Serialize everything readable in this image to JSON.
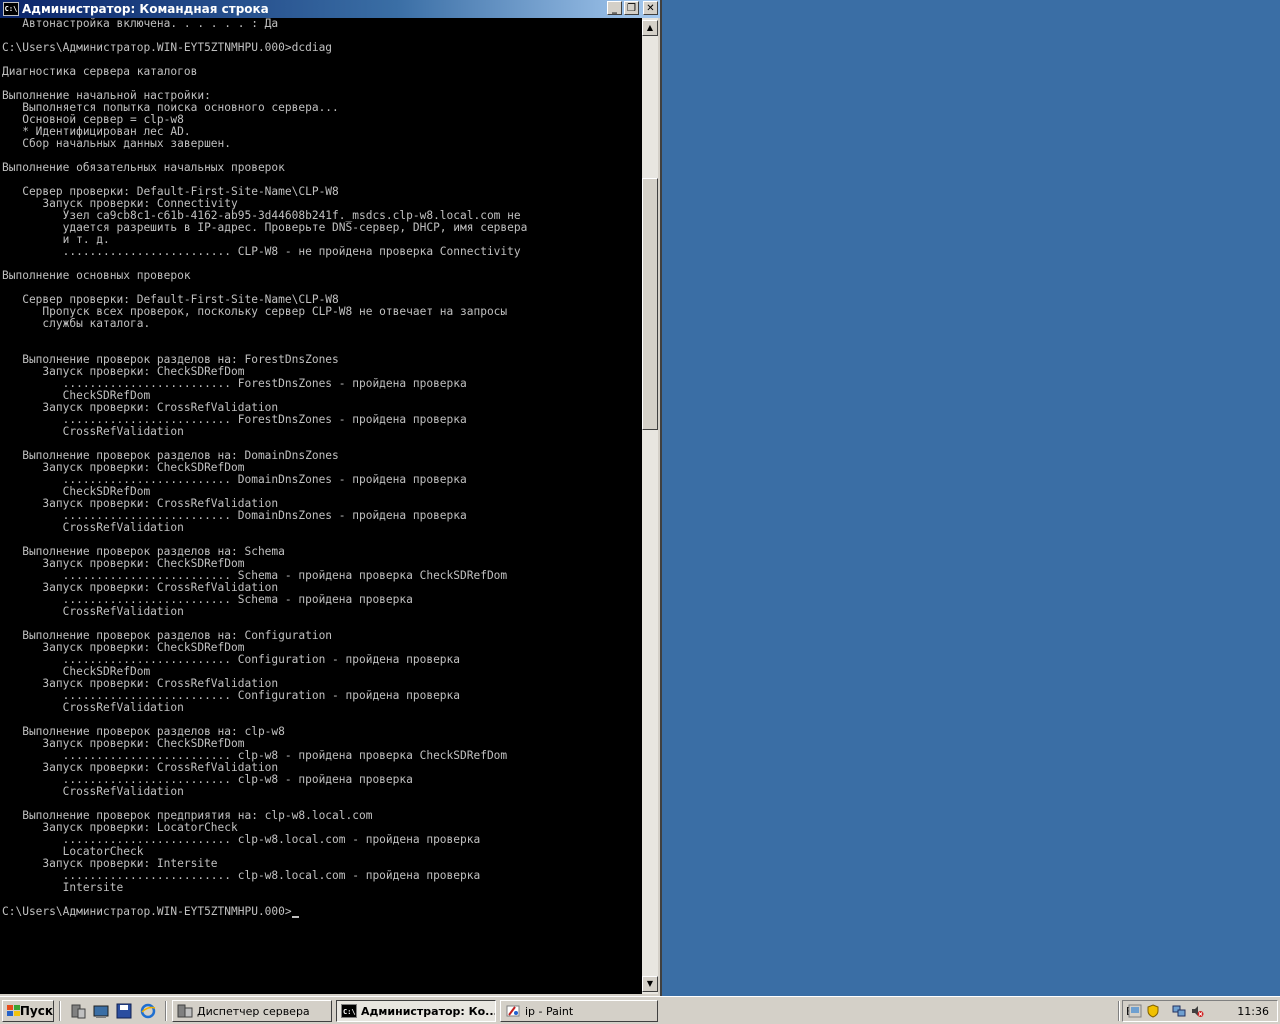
{
  "window": {
    "title": "Администратор: Командная строка",
    "app_icon_text": "C:\\",
    "buttons": {
      "minimize": "_",
      "maximize": "❐",
      "close": "✕"
    }
  },
  "console_lines": [
    "   Автонастройка включена. . . . . . : Да",
    "",
    "C:\\Users\\Администратор.WIN-EYT5ZTNMHPU.000>dcdiag",
    "",
    "Диагностика сервера каталогов",
    "",
    "Выполнение начальной настройки:",
    "   Выполняется попытка поиска основного сервера...",
    "   Основной сервер = clp-w8",
    "   * Идентифицирован лес AD.",
    "   Сбор начальных данных завершен.",
    "",
    "Выполнение обязательных начальных проверок",
    "",
    "   Сервер проверки: Default-First-Site-Name\\CLP-W8",
    "      Запуск проверки: Connectivity",
    "         Узел ca9cb8c1-c61b-4162-ab95-3d44608b241f._msdcs.clp-w8.local.com не",
    "         удается разрешить в IP-адрес. Проверьте DNS-сервер, DHCP, имя сервера",
    "         и т. д.",
    "         ......................... CLP-W8 - не пройдена проверка Connectivity",
    "",
    "Выполнение основных проверок",
    "",
    "   Сервер проверки: Default-First-Site-Name\\CLP-W8",
    "      Пропуск всех проверок, поскольку сервер CLP-W8 не отвечает на запросы",
    "      службы каталога.",
    "",
    "",
    "   Выполнение проверок разделов на: ForestDnsZones",
    "      Запуск проверки: CheckSDRefDom",
    "         ......................... ForestDnsZones - пройдена проверка",
    "         CheckSDRefDom",
    "      Запуск проверки: CrossRefValidation",
    "         ......................... ForestDnsZones - пройдена проверка",
    "         CrossRefValidation",
    "",
    "   Выполнение проверок разделов на: DomainDnsZones",
    "      Запуск проверки: CheckSDRefDom",
    "         ......................... DomainDnsZones - пройдена проверка",
    "         CheckSDRefDom",
    "      Запуск проверки: CrossRefValidation",
    "         ......................... DomainDnsZones - пройдена проверка",
    "         CrossRefValidation",
    "",
    "   Выполнение проверок разделов на: Schema",
    "      Запуск проверки: CheckSDRefDom",
    "         ......................... Schema - пройдена проверка CheckSDRefDom",
    "      Запуск проверки: CrossRefValidation",
    "         ......................... Schema - пройдена проверка",
    "         CrossRefValidation",
    "",
    "   Выполнение проверок разделов на: Configuration",
    "      Запуск проверки: CheckSDRefDom",
    "         ......................... Configuration - пройдена проверка",
    "         CheckSDRefDom",
    "      Запуск проверки: CrossRefValidation",
    "         ......................... Configuration - пройдена проверка",
    "         CrossRefValidation",
    "",
    "   Выполнение проверок разделов на: clp-w8",
    "      Запуск проверки: CheckSDRefDom",
    "         ......................... clp-w8 - пройдена проверка CheckSDRefDom",
    "      Запуск проверки: CrossRefValidation",
    "         ......................... clp-w8 - пройдена проверка",
    "         CrossRefValidation",
    "",
    "   Выполнение проверок предприятия на: clp-w8.local.com",
    "      Запуск проверки: LocatorCheck",
    "         ......................... clp-w8.local.com - пройдена проверка",
    "         LocatorCheck",
    "      Запуск проверки: Intersite",
    "         ......................... clp-w8.local.com - пройдена проверка",
    "         Intersite",
    "",
    "C:\\Users\\Администратор.WIN-EYT5ZTNMHPU.000>"
  ],
  "taskbar": {
    "start_label": "Пуск",
    "tasks": [
      {
        "label": "Диспетчер сервера",
        "icon": "server-manager-icon",
        "active": false
      },
      {
        "label": "Администратор: Ко...",
        "icon": "cmd-icon",
        "active": true
      },
      {
        "label": "ip - Paint",
        "icon": "paint-icon",
        "active": false
      }
    ],
    "language": "EN",
    "clock": "11:36"
  },
  "colors": {
    "desktop": "#3a6ea5",
    "console_bg": "#000000",
    "console_fg": "#c0c0c0",
    "titlebar": "#0a246a"
  }
}
